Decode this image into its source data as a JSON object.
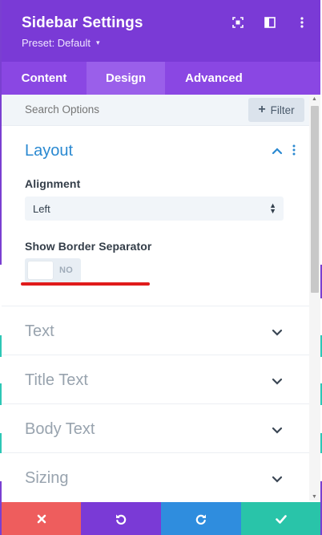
{
  "header": {
    "title": "Sidebar Settings",
    "preset_label": "Preset: Default",
    "icons": [
      "focus-icon",
      "split-view-icon",
      "more-vertical-icon"
    ]
  },
  "tabs": [
    {
      "label": "Content",
      "active": false
    },
    {
      "label": "Design",
      "active": true
    },
    {
      "label": "Advanced",
      "active": false
    }
  ],
  "search": {
    "placeholder": "Search Options",
    "filter_label": "Filter"
  },
  "layout": {
    "title": "Layout",
    "alignment_label": "Alignment",
    "alignment_value": "Left",
    "border_label": "Show Border Separator",
    "border_state": "NO"
  },
  "sections": [
    {
      "title": "Text"
    },
    {
      "title": "Title Text"
    },
    {
      "title": "Body Text"
    },
    {
      "title": "Sizing"
    }
  ],
  "footer": {
    "icons": [
      "close-icon",
      "undo-icon",
      "redo-icon",
      "check-icon"
    ]
  },
  "colors": {
    "header": "#7a3ad6",
    "tabs": "#8a47e3",
    "active_tab": "#9a5fea",
    "accent_blue": "#2a89d1",
    "cancel": "#ee5d5d",
    "undo": "#7a3ad6",
    "redo": "#2f8dde",
    "save": "#29c4a9",
    "annotation_red": "#e01b1b"
  }
}
